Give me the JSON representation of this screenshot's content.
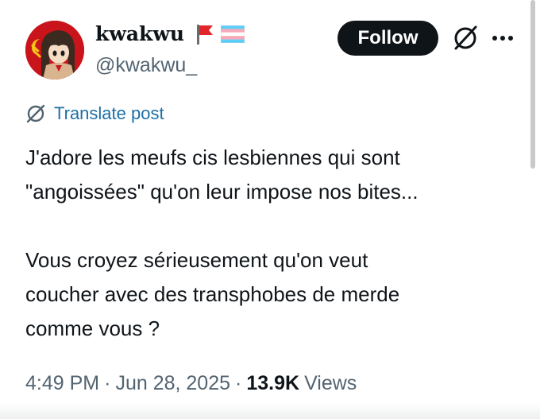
{
  "author": {
    "display_name": "kwakwu",
    "handle": "@kwakwu_",
    "avatar_icon": "anime-girl-avatar-with-hammer-sickle",
    "flags": [
      "red-flag-icon",
      "transgender-flag-icon"
    ]
  },
  "actions": {
    "follow_label": "Follow",
    "grok_icon": "grok-icon",
    "more_icon": "more-dots-icon"
  },
  "translate": {
    "label": "Translate post",
    "icon": "globe-slash-icon"
  },
  "post": {
    "text": "J'adore les meufs cis lesbiennes qui sont\n\"angoissées\" qu'on leur impose nos bites...\n\nVous croyez sérieusement qu'on veut\ncoucher avec des transphobes de merde\ncomme vous ?"
  },
  "meta": {
    "time": "4:49 PM",
    "date": "Jun 28, 2025",
    "views_count": "13.9K",
    "views_label": "Views",
    "separator": "·"
  },
  "colors": {
    "text": "#0f1419",
    "secondary": "#536471",
    "link": "#1d6fa5",
    "follow_bg": "#0f1419",
    "avatar_bg": "#c8141a"
  }
}
